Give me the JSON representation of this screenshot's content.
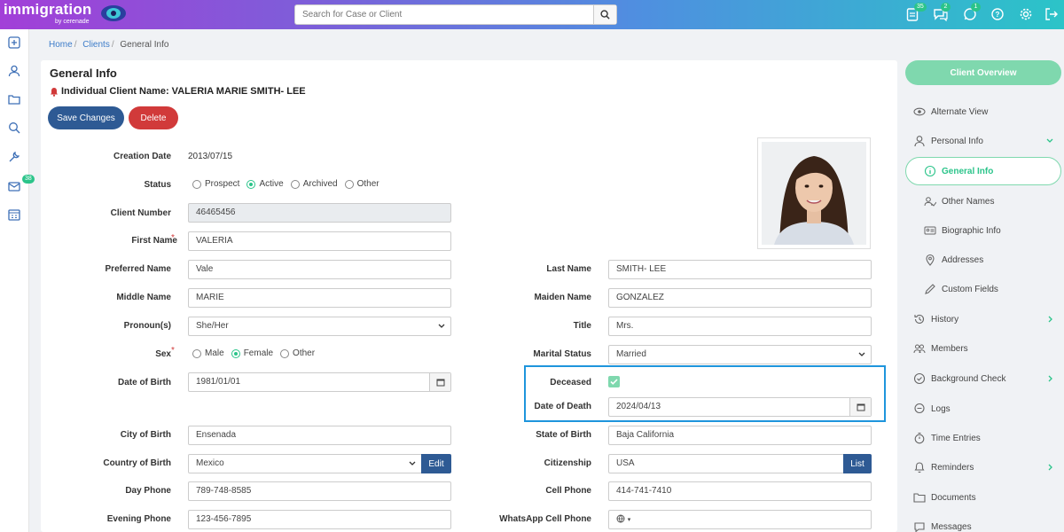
{
  "app": {
    "logo_text": "immigration",
    "logo_sub": "by cerenade"
  },
  "search": {
    "placeholder": "Search for Case or Client"
  },
  "top_badges": {
    "tasks": "35",
    "chat": "2",
    "whatsapp": "1"
  },
  "left_badges": {
    "mail": "38"
  },
  "breadcrumb": {
    "home": "Home",
    "clients": "Clients",
    "current": "General Info"
  },
  "page": {
    "title": "General Info",
    "client_name": "Individual Client Name: VALERIA MARIE SMITH- LEE",
    "save_label": "Save Changes",
    "delete_label": "Delete"
  },
  "form": {
    "creation_date_label": "Creation Date",
    "creation_date": "2013/07/15",
    "status_label": "Status",
    "status_options": [
      "Prospect",
      "Active",
      "Archived",
      "Other"
    ],
    "status_selected": "Active",
    "client_number_label": "Client Number",
    "client_number": "46465456",
    "first_name_label": "First Name",
    "first_name": "VALERIA",
    "preferred_name_label": "Preferred Name",
    "preferred_name": "Vale",
    "last_name_label": "Last Name",
    "last_name": "SMITH- LEE",
    "middle_name_label": "Middle Name",
    "middle_name": "MARIE",
    "maiden_name_label": "Maiden Name",
    "maiden_name": "GONZALEZ",
    "pronouns_label": "Pronoun(s)",
    "pronouns": "She/Her",
    "title_label": "Title",
    "title": "Mrs.",
    "sex_label": "Sex",
    "sex_options": [
      "Male",
      "Female",
      "Other"
    ],
    "sex_selected": "Female",
    "marital_status_label": "Marital Status",
    "marital_status": "Married",
    "dob_label": "Date of Birth",
    "dob": "1981/01/01",
    "deceased_label": "Deceased",
    "deceased": true,
    "dod_label": "Date of Death",
    "dod": "2024/04/13",
    "city_of_birth_label": "City of Birth",
    "city_of_birth": "Ensenada",
    "state_of_birth_label": "State of Birth",
    "state_of_birth": "Baja California",
    "country_of_birth_label": "Country of Birth",
    "country_of_birth": "Mexico",
    "edit_label": "Edit",
    "citizenship_label": "Citizenship",
    "citizenship": "USA",
    "list_label": "List",
    "day_phone_label": "Day Phone",
    "day_phone": "789-748-8585",
    "cell_phone_label": "Cell Phone",
    "cell_phone": "414-741-7410",
    "evening_phone_label": "Evening Phone",
    "evening_phone": "123-456-7895",
    "whatsapp_label": "WhatsApp Cell Phone"
  },
  "right_nav": {
    "overview": "Client Overview",
    "items": [
      {
        "label": "Alternate View",
        "icon": "eye-icon"
      },
      {
        "label": "Personal Info",
        "icon": "person-icon"
      },
      {
        "label": "General Info",
        "icon": "info-icon"
      },
      {
        "label": "Other Names",
        "icon": "people-icon"
      },
      {
        "label": "Biographic Info",
        "icon": "id-card-icon"
      },
      {
        "label": "Addresses",
        "icon": "map-pin-icon"
      },
      {
        "label": "Custom Fields",
        "icon": "pencil-icon"
      },
      {
        "label": "History",
        "icon": "history-icon"
      },
      {
        "label": "Members",
        "icon": "group-icon"
      },
      {
        "label": "Background Check",
        "icon": "check-circle-icon"
      },
      {
        "label": "Logs",
        "icon": "chat-icon"
      },
      {
        "label": "Time Entries",
        "icon": "stopwatch-icon"
      },
      {
        "label": "Reminders",
        "icon": "bell-icon"
      },
      {
        "label": "Documents",
        "icon": "folder-icon"
      },
      {
        "label": "Messages",
        "icon": "message-icon"
      }
    ]
  },
  "colors": {
    "accent": "#2bc48a",
    "primary": "#2e5a94",
    "danger": "#d13a3a",
    "highlight": "#1e95dc"
  }
}
